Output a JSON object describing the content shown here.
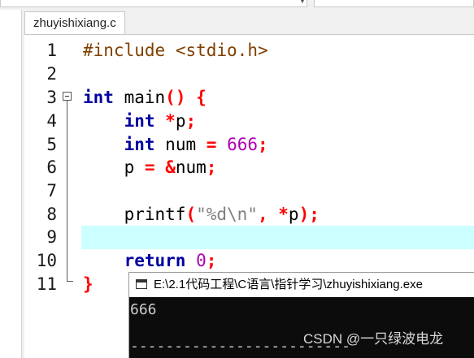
{
  "editor": {
    "tab_title": "zhuyishixiang.c",
    "line_numbers": [
      "1",
      "2",
      "3",
      "4",
      "5",
      "6",
      "7",
      "8",
      "9",
      "10",
      "11"
    ],
    "current_line": 9,
    "code": {
      "l1_directive": "#include",
      "l1_header": "<stdio.h>",
      "l3_type": "int",
      "l3_name": "main",
      "l3_paren_open": "(",
      "l3_paren_close": ")",
      "l3_brace": "{",
      "l4_type": "int",
      "l4_star": "*",
      "l4_var": "p",
      "l4_semi": ";",
      "l5_type": "int",
      "l5_var": "num",
      "l5_eq": "=",
      "l5_val": "666",
      "l5_semi": ";",
      "l6_var": "p",
      "l6_eq": "=",
      "l6_amp": "&",
      "l6_var2": "num",
      "l6_semi": ";",
      "l8_func": "printf",
      "l8_paren_open": "(",
      "l8_str": "\"%d\\n\"",
      "l8_comma": ",",
      "l8_star": "*",
      "l8_var": "p",
      "l8_paren_close": ")",
      "l8_semi": ";",
      "l10_kw": "return",
      "l10_val": "0",
      "l10_semi": ";",
      "l11_brace": "}"
    }
  },
  "console": {
    "title": "E:\\2.1代码工程\\C语言\\指针学习\\zhuyishixiang.exe",
    "output": "666",
    "separator": "------------------------------"
  },
  "watermark": "CSDN @一只绿波电龙",
  "colors": {
    "keyword": "#0000a0",
    "operator": "#ff0000",
    "number": "#b000b0",
    "preprocessor": "#804000",
    "current_line_highlight": "#ccffff",
    "console_bg": "#0c0c0c"
  }
}
